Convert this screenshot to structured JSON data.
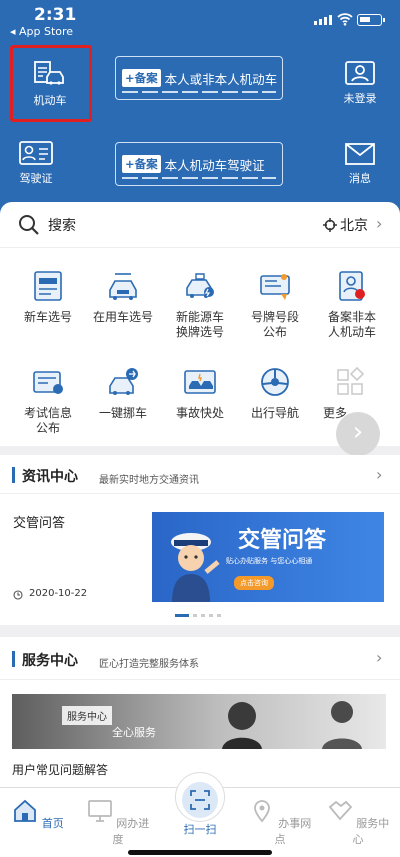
{
  "status_bar": {
    "time": "2:31",
    "back_label": "◂ App Store"
  },
  "header": {
    "motor_vehicle": "机动车",
    "not_logged_in": "未登录",
    "license": "驾驶证",
    "messages": "消息",
    "banner1": {
      "tag": "+备案",
      "text": "本人或非本人机动车"
    },
    "banner2": {
      "tag": "+备案",
      "text": "本人机动车驾驶证"
    }
  },
  "search": {
    "placeholder": "搜索",
    "city": "北京"
  },
  "services": [
    {
      "label": "新车选号",
      "icon": "new-car-number-icon"
    },
    {
      "label": "在用车选号",
      "icon": "used-car-number-icon"
    },
    {
      "label": "新能源车\n换牌选号",
      "icon": "ev-plate-icon"
    },
    {
      "label": "号牌号段\n公布",
      "icon": "plate-range-icon"
    },
    {
      "label": "备案非本\n人机动车",
      "icon": "register-vehicle-icon"
    },
    {
      "label": "考试信息\n公布",
      "icon": "exam-info-icon"
    },
    {
      "label": "一键挪车",
      "icon": "move-car-icon"
    },
    {
      "label": "事故快处",
      "icon": "accident-icon"
    },
    {
      "label": "出行导航",
      "icon": "navigation-icon"
    },
    {
      "label": "更多",
      "icon": "more-icon"
    }
  ],
  "news": {
    "title": "资讯中心",
    "subtitle": "最新实时地方交通资讯",
    "item_title": "交管问答",
    "item_date": "2020-10-22",
    "image_title": "交管问答",
    "image_sub": "贴心办贴服务   与您心心相通",
    "image_btn": "点击咨询"
  },
  "service_center": {
    "title": "服务中心",
    "subtitle": "匠心打造完整服务体系",
    "image_tag": "服务中心",
    "image_text": "全心服务",
    "faq": "用户常见问题解答"
  },
  "tabbar": [
    "首页",
    "网办进度",
    "扫一扫",
    "办事网点",
    "服务中心"
  ],
  "colors": {
    "primary": "#2b6bb4",
    "highlight": "#e02020"
  }
}
